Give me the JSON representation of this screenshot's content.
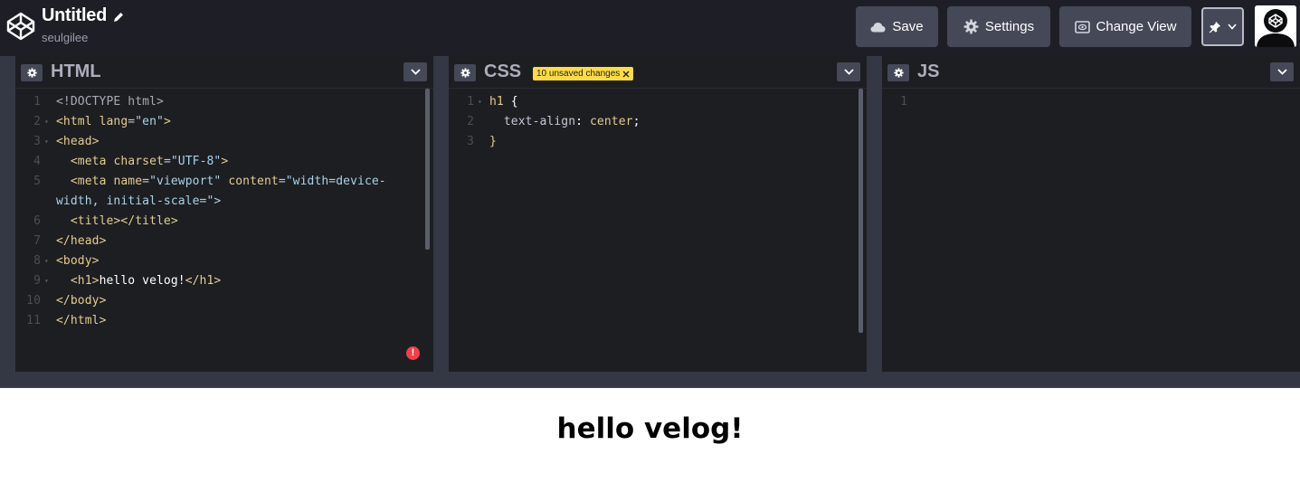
{
  "header": {
    "title": "Untitled",
    "owner": "seulgilee",
    "save_label": "Save",
    "settings_label": "Settings",
    "change_view_label": "Change View"
  },
  "panels": {
    "html": {
      "title": "HTML"
    },
    "css": {
      "title": "CSS",
      "badge": "10 unsaved changes"
    },
    "js": {
      "title": "JS"
    }
  },
  "html_lines": [
    {
      "n": "1",
      "fold": "",
      "code": "<!DOCTYPE html>"
    },
    {
      "n": "2",
      "fold": "▾",
      "code": "<html lang=\"en\">"
    },
    {
      "n": "3",
      "fold": "▾",
      "code": "<head>"
    },
    {
      "n": "4",
      "fold": "",
      "code": "  <meta charset=\"UTF-8\">"
    },
    {
      "n": "5",
      "fold": "",
      "code": "  <meta name=\"viewport\" content=\"width=device-"
    },
    {
      "n": "",
      "fold": "",
      "code": "width, initial-scale=\">"
    },
    {
      "n": "6",
      "fold": "",
      "code": "  <title></title>"
    },
    {
      "n": "7",
      "fold": "",
      "code": "</head>"
    },
    {
      "n": "8",
      "fold": "▾",
      "code": "<body>"
    },
    {
      "n": "9",
      "fold": "▾",
      "code": "  <h1>hello velog!</h1>"
    },
    {
      "n": "10",
      "fold": "",
      "code": "</body>"
    },
    {
      "n": "11",
      "fold": "",
      "code": "</html>"
    }
  ],
  "css_lines": [
    {
      "n": "1",
      "fold": "▾",
      "code": "h1 {"
    },
    {
      "n": "2",
      "fold": "",
      "code": "  text-align: center;"
    },
    {
      "n": "3",
      "fold": "",
      "code": "}"
    }
  ],
  "js_lines": [
    {
      "n": "1",
      "fold": "",
      "code": ""
    }
  ],
  "preview": {
    "heading": "hello velog!"
  },
  "colors": {
    "header_bg": "#1e1f26",
    "button_bg": "#444857",
    "editor_bg": "#1d1e22",
    "badge_bg": "#ffdd40",
    "error": "#f43f4a"
  }
}
